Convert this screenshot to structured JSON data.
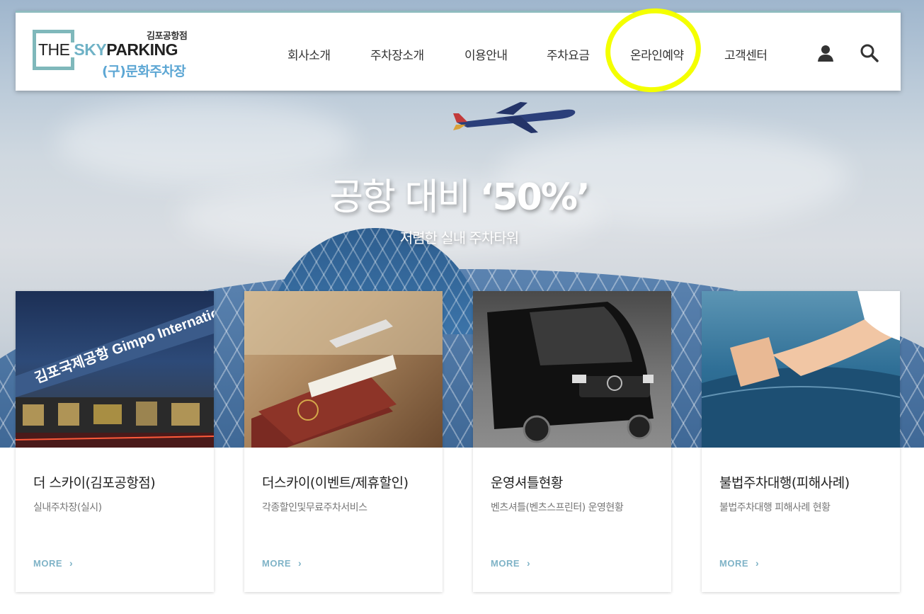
{
  "header": {
    "logo": {
      "branch": "김포공항점",
      "brand_the": "THE ",
      "brand_sky": "SKY",
      "brand_parking": "PARKING",
      "old_name": "(구)문화주차장"
    },
    "nav": [
      {
        "label": "회사소개"
      },
      {
        "label": "주차장소개"
      },
      {
        "label": "이용안내"
      },
      {
        "label": "주차요금"
      },
      {
        "label": "온라인예약"
      },
      {
        "label": "고객센터"
      }
    ],
    "icons": [
      "user-icon",
      "search-icon"
    ]
  },
  "hero": {
    "title_light": "공항 대비 ",
    "title_strong": "‘50%’",
    "subtitle": "저렴한 실내 주차타워"
  },
  "cards": [
    {
      "title": "더 스카이(김포공항점)",
      "desc": "실내주차장(실시)",
      "more": "MORE",
      "image_text": "김포국제공항 Gimpo International Airport"
    },
    {
      "title": "더스카이(이벤트/제휴할인)",
      "desc": "각종할인및무료주차서비스",
      "more": "MORE"
    },
    {
      "title": "운영셔틀현황",
      "desc": "벤츠셔틀(벤츠스프린터) 운영현황",
      "more": "MORE"
    },
    {
      "title": "불법주차대행(피해사례)",
      "desc": "불법주차대행 피해사례 현황",
      "more": "MORE"
    }
  ],
  "colors": {
    "accent": "#7fb8bb",
    "sky": "#6fb2c6",
    "old_name": "#5da7d4",
    "more": "#7fb3c7",
    "highlight": "#f4ff00"
  }
}
